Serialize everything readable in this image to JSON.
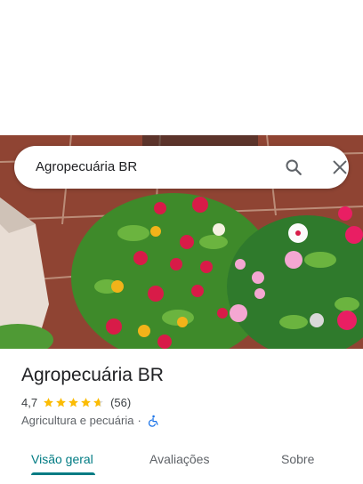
{
  "search": {
    "query": "Agropecuária BR"
  },
  "icons": {
    "search": "search-icon",
    "close": "close-icon",
    "star": "star-icon",
    "wheelchair": "wheelchair-accessible-icon"
  },
  "place": {
    "title": "Agropecuária BR",
    "rating": "4,7",
    "stars": 4.7,
    "reviews": "(56)",
    "category": "Agricultura e pecuária",
    "separator": "·"
  },
  "tabs": [
    {
      "label": "Visão geral",
      "active": true
    },
    {
      "label": "Avaliações",
      "active": false
    },
    {
      "label": "Sobre",
      "active": false
    }
  ],
  "colors": {
    "accent": "#007b83",
    "star": "#fbbc04",
    "accessibility_icon": "#1a73e8"
  }
}
